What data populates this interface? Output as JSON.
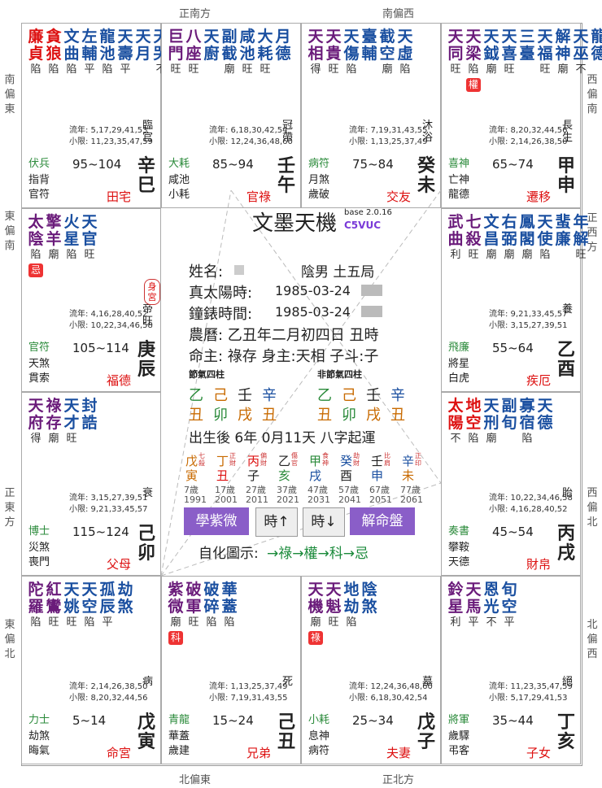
{
  "dirs": {
    "top_left": "正南方",
    "top_right": "南偏西",
    "bottom_left": "北偏東",
    "bottom_right": "正北方",
    "left_1": "南偏東",
    "left_2": "東偏南",
    "left_3": "正東方",
    "left_4": "東偏北",
    "right_1": "西偏南",
    "right_2": "正西方",
    "right_3": "西偏北",
    "right_4": "北偏西"
  },
  "palaces": {
    "si": {
      "stars": [
        [
          "廉",
          "陷",
          "red"
        ],
        [
          "貪",
          "陷",
          "red"
        ],
        [
          "文",
          "陷",
          "blue"
        ],
        [
          "左",
          "平",
          "blue"
        ],
        [
          "龍",
          "陷",
          "blue"
        ],
        [
          "天",
          "平",
          "blue"
        ],
        [
          "天",
          "",
          ""
        ],
        [
          "天",
          "不",
          "blue"
        ]
      ],
      "stars2": [
        "貞",
        "狼",
        "曲",
        "輔",
        "池",
        "壽",
        "月",
        "哭"
      ],
      "flow": "流年: 5,17,29,41,53",
      "small": "小限: 11,23,35,47,59",
      "god1": "伏兵",
      "god2": "指背",
      "god3": "官符",
      "range": "95~104",
      "palace": "田宅",
      "gz1": "辛",
      "gz2": "巳",
      "life": "臨官"
    },
    "wu": {
      "stars": [
        "巨",
        "八",
        "天",
        "副",
        "咸",
        "大",
        "月"
      ],
      "stars2": [
        "門",
        "座",
        "廚",
        "截",
        "池",
        "耗",
        "德"
      ],
      "br": [
        "旺",
        "旺",
        "",
        "廟",
        "旺",
        "旺",
        ""
      ],
      "flow": "流年: 6,18,30,42,54",
      "small": "小限: 12,24,36,48,60",
      "god1": "大耗",
      "god2": "咸池",
      "god3": "小耗",
      "range": "85~94",
      "palace": "官祿",
      "gz1": "壬",
      "gz2": "午",
      "life": "冠帶"
    },
    "wei": {
      "stars": [
        "天",
        "天",
        "天",
        "臺",
        "截",
        "天"
      ],
      "stars2": [
        "相",
        "貴",
        "傷",
        "輔",
        "空",
        "虛"
      ],
      "br": [
        "得",
        "旺",
        "陷",
        "",
        "廟",
        "陷"
      ],
      "flow": "流年: 7,19,31,43,55",
      "small": "小限: 1,13,25,37,49",
      "god1": "病符",
      "god2": "月煞",
      "god3": "歲破",
      "range": "75~84",
      "palace": "交友",
      "gz1": "癸",
      "gz2": "未",
      "life": "沐浴"
    },
    "shen": {
      "stars": [
        "天",
        "天",
        "天",
        "天",
        "三",
        "天",
        "解",
        "天",
        "龍"
      ],
      "stars2": [
        "同",
        "梁",
        "鉞",
        "喜",
        "臺",
        "福",
        "神",
        "巫",
        "德"
      ],
      "br": [
        "旺",
        "陷",
        "廟",
        "旺",
        "",
        "旺",
        "廟",
        "不",
        ""
      ],
      "hua": "權",
      "flow": "流年: 8,20,32,44,56",
      "small": "小限: 2,14,26,38,50",
      "god1": "喜神",
      "god2": "亡神",
      "god3": "龍德",
      "range": "65~74",
      "palace": "遷移",
      "gz1": "甲",
      "gz2": "申",
      "life": "長生"
    },
    "chen": {
      "stars": [
        "太",
        "擎",
        "火",
        "天"
      ],
      "stars2": [
        "陰",
        "羊",
        "星",
        "官"
      ],
      "br": [
        "陷",
        "廟",
        "陷",
        "旺"
      ],
      "hua": "忌",
      "tag": "身宮",
      "flow": "流年: 4,16,28,40,52",
      "small": "小限: 10,22,34,46,58",
      "god1": "官符",
      "god2": "天煞",
      "god3": "貫索",
      "range": "105~114",
      "palace": "福德",
      "gz1": "庚",
      "gz2": "辰",
      "life": "帝旺"
    },
    "you": {
      "stars": [
        "武",
        "七",
        "文",
        "右",
        "鳳",
        "天",
        "蜚",
        "年"
      ],
      "stars2": [
        "曲",
        "殺",
        "昌",
        "弼",
        "閣",
        "使",
        "廉",
        "解"
      ],
      "br": [
        "利",
        "旺",
        "廟",
        "廟",
        "廟",
        "陷",
        "",
        "旺"
      ],
      "flow": "流年: 9,21,33,45,57",
      "small": "小限: 3,15,27,39,51",
      "god1": "飛廉",
      "god2": "將星",
      "god3": "白虎",
      "range": "55~64",
      "palace": "疾厄",
      "gz1": "乙",
      "gz2": "酉",
      "life": "養"
    },
    "mao": {
      "stars": [
        "天",
        "祿",
        "天",
        "封"
      ],
      "stars2": [
        "府",
        "存",
        "才",
        "誥"
      ],
      "br": [
        "得",
        "廟",
        "旺",
        ""
      ],
      "flow": "流年: 3,15,27,39,51",
      "small": "小限: 9,21,33,45,57",
      "god1": "博士",
      "god2": "災煞",
      "god3": "喪門",
      "range": "115~124",
      "palace": "父母",
      "gz1": "己",
      "gz2": "卯",
      "life": "衰"
    },
    "xu": {
      "stars": [
        "太",
        "地",
        "天",
        "副",
        "寡",
        "天"
      ],
      "stars2": [
        "陽",
        "空",
        "刑",
        "旬",
        "宿",
        "德"
      ],
      "br": [
        "不",
        "陷",
        "廟",
        "",
        "陷",
        ""
      ],
      "flow": "流年: 10,22,34,46,58",
      "small": "小限: 4,16,28,40,52",
      "god1": "奏書",
      "god2": "攀鞍",
      "god3": "天德",
      "range": "45~54",
      "palace": "財帛",
      "gz1": "丙",
      "gz2": "戌",
      "life": "胎"
    },
    "yin": {
      "stars": [
        "陀",
        "紅",
        "天",
        "天",
        "孤",
        "劫"
      ],
      "stars2": [
        "羅",
        "鸞",
        "姚",
        "空",
        "辰",
        "煞"
      ],
      "br": [
        "陷",
        "旺",
        "旺",
        "陷",
        "平",
        ""
      ],
      "flow": "流年: 2,14,26,38,50",
      "small": "小限: 8,20,32,44,56",
      "god1": "力士",
      "god2": "劫煞",
      "god3": "晦氣",
      "range": "5~14",
      "palace": "命宮",
      "gz1": "戊",
      "gz2": "寅",
      "life": "病"
    },
    "chou": {
      "stars": [
        "紫",
        "破",
        "破",
        "華"
      ],
      "stars2": [
        "微",
        "軍",
        "碎",
        "蓋"
      ],
      "br": [
        "廟",
        "旺",
        "陷",
        "陷"
      ],
      "hua": "科",
      "flow": "流年: 1,13,25,37,49",
      "small": "小限: 7,19,31,43,55",
      "god1": "青龍",
      "god2": "華蓋",
      "god3": "歲建",
      "range": "15~24",
      "palace": "兄弟",
      "gz1": "己",
      "gz2": "丑",
      "life": "死"
    },
    "zi": {
      "stars": [
        "天",
        "天",
        "地",
        "陰"
      ],
      "stars2": [
        "機",
        "魁",
        "劫",
        "煞"
      ],
      "br": [
        "廟",
        "旺",
        "陷",
        ""
      ],
      "hua": "祿",
      "flow": "流年: 12,24,36,48,60",
      "small": "小限: 6,18,30,42,54",
      "god1": "小耗",
      "god2": "息神",
      "god3": "病符",
      "range": "25~34",
      "palace": "夫妻",
      "gz1": "戊",
      "gz2": "子",
      "life": "墓"
    },
    "hai": {
      "stars": [
        "鈴",
        "天",
        "恩",
        "旬"
      ],
      "stars2": [
        "星",
        "馬",
        "光",
        "空"
      ],
      "br": [
        "利",
        "平",
        "不",
        "平"
      ],
      "flow": "流年: 11,23,35,47,59",
      "small": "小限: 5,17,29,41,53",
      "god1": "將軍",
      "god2": "歲驛",
      "god3": "弔客",
      "range": "35~44",
      "palace": "子女",
      "gz1": "丁",
      "gz2": "亥",
      "life": "絕"
    }
  },
  "center": {
    "title": "文墨天機",
    "version": "base 2.0.16",
    "code": "C5VUC",
    "name_label": "姓名:",
    "gender": "陰男 土五局",
    "solar_label": "真太陽時:",
    "solar": "1985-03-24",
    "clock_label": "鐘錶時間:",
    "clock": "1985-03-24",
    "lunar": "農曆: 乙丑年二月初四日 丑時",
    "master": "命主: 祿存 身主:天相 子斗:子",
    "pillar_a": "節氣四柱",
    "pillar_b": "非節氣四柱",
    "stems_a": [
      "乙",
      "己",
      "壬",
      "辛"
    ],
    "branches_a": [
      "丑",
      "卯",
      "戌",
      "丑"
    ],
    "stems_b": [
      "乙",
      "己",
      "壬",
      "辛"
    ],
    "branches_b": [
      "丑",
      "卯",
      "戌",
      "丑"
    ],
    "after": "出生後 6年 0月11天 八字起運",
    "luck_top": [
      "戊",
      "丁",
      "丙",
      "乙",
      "甲",
      "癸",
      "壬",
      "辛"
    ],
    "luck_bot": [
      "寅",
      "丑",
      "子",
      "亥",
      "戌",
      "酉",
      "申",
      "未"
    ],
    "luck_tag": [
      "七殺",
      "正財",
      "偏財",
      "傷官",
      "食神",
      "劫財",
      "比肩",
      "正印"
    ],
    "ages": [
      "7歲",
      "17歲",
      "27歲",
      "37歲",
      "47歲",
      "57歲",
      "67歲",
      "77歲"
    ],
    "years": [
      "1991",
      "2001",
      "2011",
      "2021",
      "2031",
      "2041",
      "2051",
      "2061"
    ],
    "btn_learn": "學紫微",
    "btn_up": "時↑",
    "btn_down": "時↓",
    "btn_chart": "解命盤",
    "legend_label": "自化圖示:",
    "legend": "→祿→權→科→忌"
  }
}
